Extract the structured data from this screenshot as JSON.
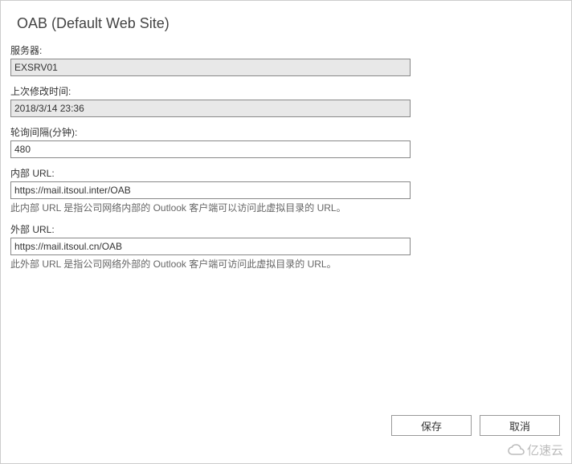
{
  "header": {
    "title": "OAB (Default Web Site)"
  },
  "fields": {
    "server": {
      "label": "服务器:",
      "value": "EXSRV01"
    },
    "lastModified": {
      "label": "上次修改时间:",
      "value": "2018/3/14 23:36"
    },
    "pollingInterval": {
      "label": "轮询间隔(分钟):",
      "value": "480"
    },
    "internalUrl": {
      "label": "内部 URL:",
      "value": "https://mail.itsoul.inter/OAB",
      "help": "此内部 URL 是指公司网络内部的 Outlook 客户端可以访问此虚拟目录的 URL。"
    },
    "externalUrl": {
      "label": "外部 URL:",
      "value": "https://mail.itsoul.cn/OAB",
      "help": "此外部 URL 是指公司网络外部的 Outlook 客户端可访问此虚拟目录的 URL。"
    }
  },
  "footer": {
    "save": "保存",
    "cancel": "取消"
  },
  "watermark": {
    "text": "亿速云"
  }
}
